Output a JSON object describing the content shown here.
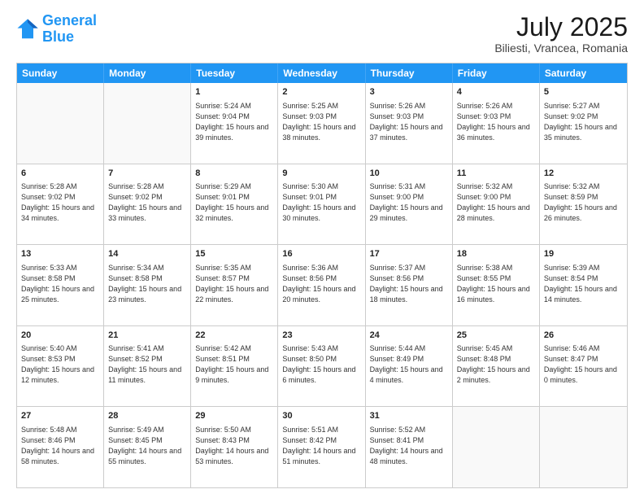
{
  "header": {
    "logo_line1": "General",
    "logo_line2": "Blue",
    "title": "July 2025",
    "subtitle": "Biliesti, Vrancea, Romania"
  },
  "days_of_week": [
    "Sunday",
    "Monday",
    "Tuesday",
    "Wednesday",
    "Thursday",
    "Friday",
    "Saturday"
  ],
  "weeks": [
    [
      {
        "day": "",
        "sunrise": "",
        "sunset": "",
        "daylight": "",
        "empty": true
      },
      {
        "day": "",
        "sunrise": "",
        "sunset": "",
        "daylight": "",
        "empty": true
      },
      {
        "day": "1",
        "sunrise": "Sunrise: 5:24 AM",
        "sunset": "Sunset: 9:04 PM",
        "daylight": "Daylight: 15 hours and 39 minutes."
      },
      {
        "day": "2",
        "sunrise": "Sunrise: 5:25 AM",
        "sunset": "Sunset: 9:03 PM",
        "daylight": "Daylight: 15 hours and 38 minutes."
      },
      {
        "day": "3",
        "sunrise": "Sunrise: 5:26 AM",
        "sunset": "Sunset: 9:03 PM",
        "daylight": "Daylight: 15 hours and 37 minutes."
      },
      {
        "day": "4",
        "sunrise": "Sunrise: 5:26 AM",
        "sunset": "Sunset: 9:03 PM",
        "daylight": "Daylight: 15 hours and 36 minutes."
      },
      {
        "day": "5",
        "sunrise": "Sunrise: 5:27 AM",
        "sunset": "Sunset: 9:02 PM",
        "daylight": "Daylight: 15 hours and 35 minutes."
      }
    ],
    [
      {
        "day": "6",
        "sunrise": "Sunrise: 5:28 AM",
        "sunset": "Sunset: 9:02 PM",
        "daylight": "Daylight: 15 hours and 34 minutes."
      },
      {
        "day": "7",
        "sunrise": "Sunrise: 5:28 AM",
        "sunset": "Sunset: 9:02 PM",
        "daylight": "Daylight: 15 hours and 33 minutes."
      },
      {
        "day": "8",
        "sunrise": "Sunrise: 5:29 AM",
        "sunset": "Sunset: 9:01 PM",
        "daylight": "Daylight: 15 hours and 32 minutes."
      },
      {
        "day": "9",
        "sunrise": "Sunrise: 5:30 AM",
        "sunset": "Sunset: 9:01 PM",
        "daylight": "Daylight: 15 hours and 30 minutes."
      },
      {
        "day": "10",
        "sunrise": "Sunrise: 5:31 AM",
        "sunset": "Sunset: 9:00 PM",
        "daylight": "Daylight: 15 hours and 29 minutes."
      },
      {
        "day": "11",
        "sunrise": "Sunrise: 5:32 AM",
        "sunset": "Sunset: 9:00 PM",
        "daylight": "Daylight: 15 hours and 28 minutes."
      },
      {
        "day": "12",
        "sunrise": "Sunrise: 5:32 AM",
        "sunset": "Sunset: 8:59 PM",
        "daylight": "Daylight: 15 hours and 26 minutes."
      }
    ],
    [
      {
        "day": "13",
        "sunrise": "Sunrise: 5:33 AM",
        "sunset": "Sunset: 8:58 PM",
        "daylight": "Daylight: 15 hours and 25 minutes."
      },
      {
        "day": "14",
        "sunrise": "Sunrise: 5:34 AM",
        "sunset": "Sunset: 8:58 PM",
        "daylight": "Daylight: 15 hours and 23 minutes."
      },
      {
        "day": "15",
        "sunrise": "Sunrise: 5:35 AM",
        "sunset": "Sunset: 8:57 PM",
        "daylight": "Daylight: 15 hours and 22 minutes."
      },
      {
        "day": "16",
        "sunrise": "Sunrise: 5:36 AM",
        "sunset": "Sunset: 8:56 PM",
        "daylight": "Daylight: 15 hours and 20 minutes."
      },
      {
        "day": "17",
        "sunrise": "Sunrise: 5:37 AM",
        "sunset": "Sunset: 8:56 PM",
        "daylight": "Daylight: 15 hours and 18 minutes."
      },
      {
        "day": "18",
        "sunrise": "Sunrise: 5:38 AM",
        "sunset": "Sunset: 8:55 PM",
        "daylight": "Daylight: 15 hours and 16 minutes."
      },
      {
        "day": "19",
        "sunrise": "Sunrise: 5:39 AM",
        "sunset": "Sunset: 8:54 PM",
        "daylight": "Daylight: 15 hours and 14 minutes."
      }
    ],
    [
      {
        "day": "20",
        "sunrise": "Sunrise: 5:40 AM",
        "sunset": "Sunset: 8:53 PM",
        "daylight": "Daylight: 15 hours and 12 minutes."
      },
      {
        "day": "21",
        "sunrise": "Sunrise: 5:41 AM",
        "sunset": "Sunset: 8:52 PM",
        "daylight": "Daylight: 15 hours and 11 minutes."
      },
      {
        "day": "22",
        "sunrise": "Sunrise: 5:42 AM",
        "sunset": "Sunset: 8:51 PM",
        "daylight": "Daylight: 15 hours and 9 minutes."
      },
      {
        "day": "23",
        "sunrise": "Sunrise: 5:43 AM",
        "sunset": "Sunset: 8:50 PM",
        "daylight": "Daylight: 15 hours and 6 minutes."
      },
      {
        "day": "24",
        "sunrise": "Sunrise: 5:44 AM",
        "sunset": "Sunset: 8:49 PM",
        "daylight": "Daylight: 15 hours and 4 minutes."
      },
      {
        "day": "25",
        "sunrise": "Sunrise: 5:45 AM",
        "sunset": "Sunset: 8:48 PM",
        "daylight": "Daylight: 15 hours and 2 minutes."
      },
      {
        "day": "26",
        "sunrise": "Sunrise: 5:46 AM",
        "sunset": "Sunset: 8:47 PM",
        "daylight": "Daylight: 15 hours and 0 minutes."
      }
    ],
    [
      {
        "day": "27",
        "sunrise": "Sunrise: 5:48 AM",
        "sunset": "Sunset: 8:46 PM",
        "daylight": "Daylight: 14 hours and 58 minutes."
      },
      {
        "day": "28",
        "sunrise": "Sunrise: 5:49 AM",
        "sunset": "Sunset: 8:45 PM",
        "daylight": "Daylight: 14 hours and 55 minutes."
      },
      {
        "day": "29",
        "sunrise": "Sunrise: 5:50 AM",
        "sunset": "Sunset: 8:43 PM",
        "daylight": "Daylight: 14 hours and 53 minutes."
      },
      {
        "day": "30",
        "sunrise": "Sunrise: 5:51 AM",
        "sunset": "Sunset: 8:42 PM",
        "daylight": "Daylight: 14 hours and 51 minutes."
      },
      {
        "day": "31",
        "sunrise": "Sunrise: 5:52 AM",
        "sunset": "Sunset: 8:41 PM",
        "daylight": "Daylight: 14 hours and 48 minutes."
      },
      {
        "day": "",
        "sunrise": "",
        "sunset": "",
        "daylight": "",
        "empty": true
      },
      {
        "day": "",
        "sunrise": "",
        "sunset": "",
        "daylight": "",
        "empty": true
      }
    ]
  ]
}
